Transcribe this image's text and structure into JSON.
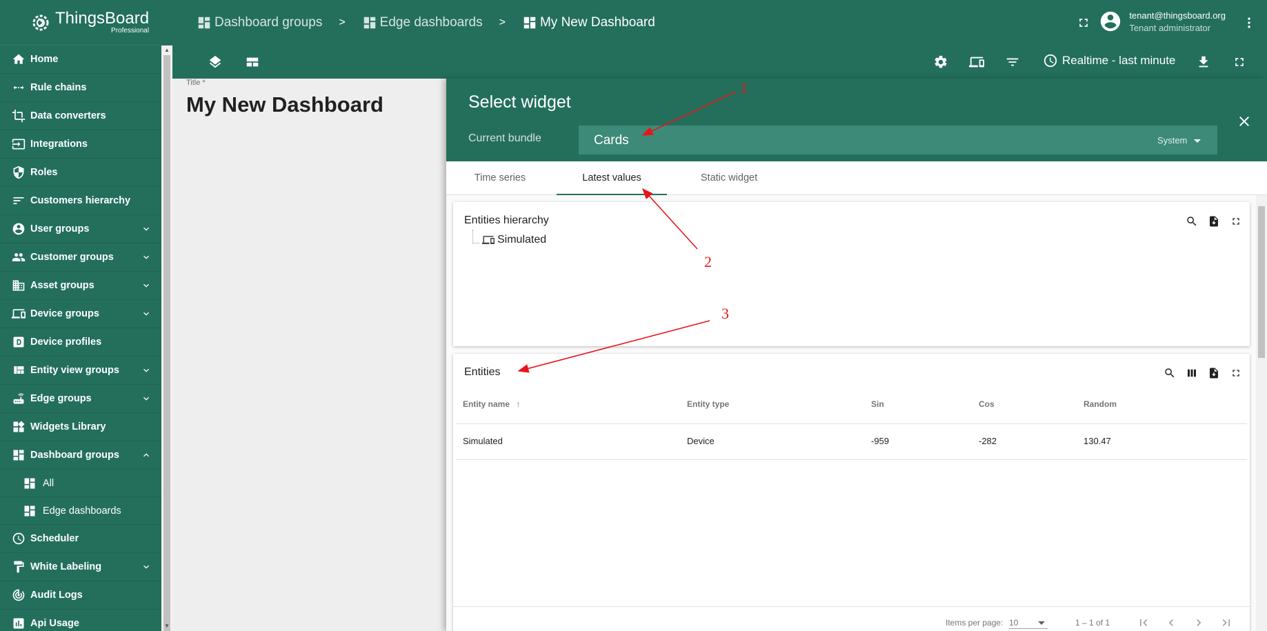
{
  "logo": {
    "name": "ThingsBoard",
    "sub": "Professional"
  },
  "sidebar": {
    "items": [
      {
        "label": "Home",
        "icon": "home-icon"
      },
      {
        "label": "Rule chains",
        "icon": "rule-chain-icon"
      },
      {
        "label": "Data converters",
        "icon": "crop-icon"
      },
      {
        "label": "Integrations",
        "icon": "input-icon"
      },
      {
        "label": "Roles",
        "icon": "shield-icon"
      },
      {
        "label": "Customers hierarchy",
        "icon": "sort-icon"
      },
      {
        "label": "User groups",
        "icon": "account-circle-icon",
        "expandable": true
      },
      {
        "label": "Customer groups",
        "icon": "people-icon",
        "expandable": true
      },
      {
        "label": "Asset groups",
        "icon": "domain-icon",
        "expandable": true
      },
      {
        "label": "Device groups",
        "icon": "devices-icon",
        "expandable": true
      },
      {
        "label": "Device profiles",
        "icon": "device-profile-icon"
      },
      {
        "label": "Entity view groups",
        "icon": "view-quilt-icon",
        "expandable": true
      },
      {
        "label": "Edge groups",
        "icon": "router-icon",
        "expandable": true
      },
      {
        "label": "Widgets Library",
        "icon": "widgets-icon"
      },
      {
        "label": "Dashboard groups",
        "icon": "dashboard-icon",
        "expanded": true
      },
      {
        "label": "All",
        "icon": "dashboard-icon",
        "sub": true
      },
      {
        "label": "Edge dashboards",
        "icon": "dashboard-icon",
        "sub": true
      },
      {
        "label": "Scheduler",
        "icon": "schedule-icon"
      },
      {
        "label": "White Labeling",
        "icon": "format-paint-icon",
        "expandable": true
      },
      {
        "label": "Audit Logs",
        "icon": "track-changes-icon"
      },
      {
        "label": "Api Usage",
        "icon": "insert-chart-icon"
      }
    ]
  },
  "breadcrumb": {
    "items": [
      "Dashboard groups",
      "Edge dashboards",
      "My New Dashboard"
    ],
    "separator": ">"
  },
  "user": {
    "email": "tenant@thingsboard.org",
    "role": "Tenant administrator"
  },
  "toolbar": {
    "timewindow": "Realtime - last minute"
  },
  "dashboard": {
    "title_label": "Title *",
    "title": "My New Dashboard"
  },
  "select_widget": {
    "title": "Select widget",
    "bundle_label": "Current bundle",
    "bundle_value": "Cards",
    "bundle_scope": "System",
    "tabs": [
      "Time series",
      "Latest values",
      "Static widget"
    ],
    "active_tab": "Latest values"
  },
  "widgets": {
    "hierarchy": {
      "title": "Entities hierarchy",
      "node": "Simulated"
    },
    "entities": {
      "title": "Entities",
      "columns": [
        "Entity name",
        "Entity type",
        "Sin",
        "Cos",
        "Random"
      ],
      "rows": [
        [
          "Simulated",
          "Device",
          "-959",
          "-282",
          "130.47"
        ]
      ],
      "items_per_page_label": "Items per page:",
      "items_per_page": "10",
      "range": "1 – 1 of 1"
    }
  },
  "annotations": [
    "1",
    "2",
    "3"
  ],
  "colors": {
    "primary": "#236f5c",
    "bundle_bg": "#3d8a78",
    "annotation": "#e8141a"
  }
}
